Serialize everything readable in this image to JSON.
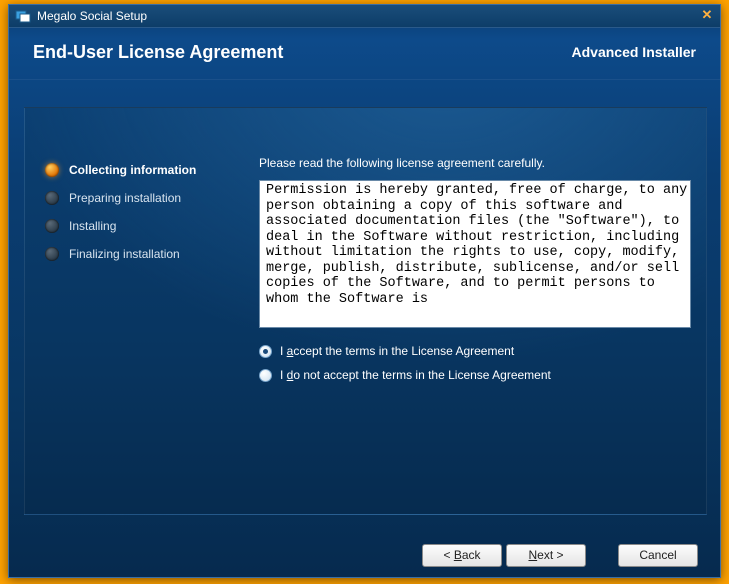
{
  "window": {
    "title": "Megalo Social Setup"
  },
  "header": {
    "page_title": "End-User License Agreement",
    "brand": "Advanced Installer"
  },
  "steps": [
    {
      "label": "Collecting information",
      "active": true
    },
    {
      "label": "Preparing installation",
      "active": false
    },
    {
      "label": "Installing",
      "active": false
    },
    {
      "label": "Finalizing installation",
      "active": false
    }
  ],
  "content": {
    "instruction": "Please read the following license agreement carefully.",
    "license_text": "Permission is hereby granted, free of charge, to any person obtaining a copy of this software and associated documentation files (the \"Software\"), to deal in the Software without restriction, including without limitation the rights to use, copy, modify, merge, publish, distribute, sublicense, and/or sell copies of the Software, and to permit persons to whom the Software is",
    "accept_pre": "I ",
    "accept_u": "a",
    "accept_post": "ccept the terms in the License Agreement",
    "decline_pre": "I ",
    "decline_u": "d",
    "decline_post": "o not accept the terms in the License Agreement"
  },
  "buttons": {
    "back_pre": "< ",
    "back_u": "B",
    "back_post": "ack",
    "next_u": "N",
    "next_post": "ext >",
    "cancel": "Cancel"
  }
}
